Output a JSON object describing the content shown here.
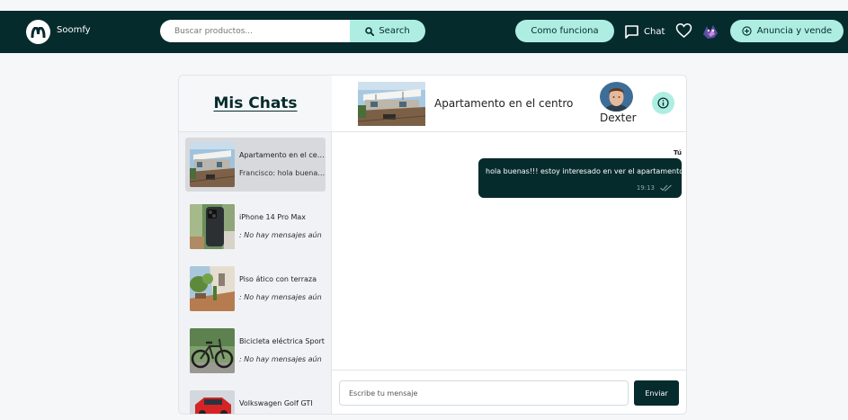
{
  "navbar": {
    "brand": "Soomfy",
    "search_placeholder": "Buscar productos...",
    "search_label": "Search",
    "how_label": "Como funciona",
    "chat_label": "Chat",
    "sell_label": "Anuncia y vende"
  },
  "sidebar": {
    "title": "Mis Chats",
    "items": [
      {
        "title": "Apartamento en el centro",
        "subtitle": "Francisco: hola buenas!!! estoy interesado"
      },
      {
        "title": "iPhone 14 Pro Max",
        "subtitle": ": No hay mensajes aún"
      },
      {
        "title": "Piso ático con terraza",
        "subtitle": ": No hay mensajes aún"
      },
      {
        "title": "Bicicleta eléctrica Sport",
        "subtitle": ": No hay mensajes aún"
      },
      {
        "title": "Volkswagen Golf GTI",
        "subtitle": ""
      }
    ]
  },
  "conversation": {
    "title": "Apartamento en el centro",
    "user_name": "Dexter",
    "messages": [
      {
        "sender": "Tú",
        "text": "hola buenas!!! estoy interesado en ver el apartamento",
        "time": "19:13"
      }
    ],
    "input_placeholder": "Escribe tu mensaje",
    "send_label": "Enviar"
  },
  "colors": {
    "primary": "#062b2d",
    "accent": "#aeeee2"
  }
}
